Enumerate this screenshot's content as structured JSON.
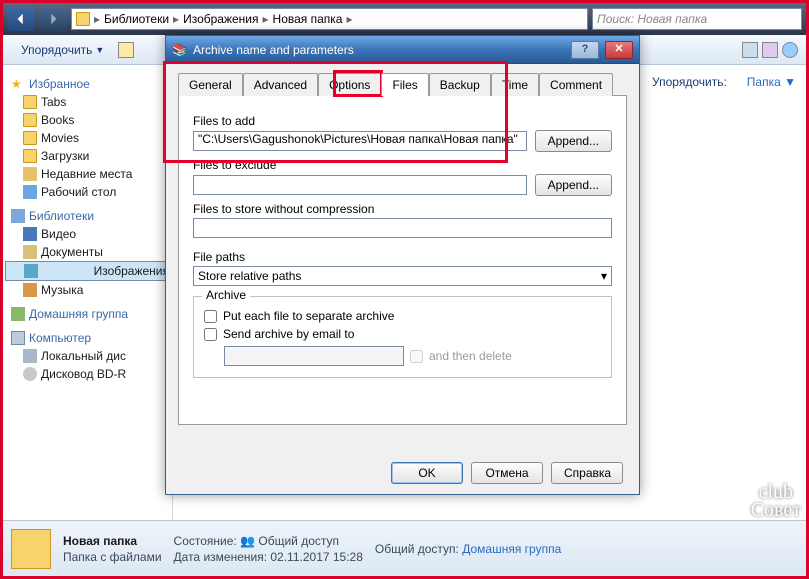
{
  "breadcrumb": {
    "p1": "Библиотеки",
    "p2": "Изображения",
    "p3": "Новая папка"
  },
  "search": {
    "placeholder": "Поиск: Новая папка"
  },
  "toolbar": {
    "organize": "Упорядочить"
  },
  "right_header": {
    "sort_label": "Упорядочить:",
    "sort_value": "Папка"
  },
  "tree": {
    "favorites": "Избранное",
    "tabs": "Tabs",
    "books": "Books",
    "movies": "Movies",
    "downloads": "Загрузки",
    "recent": "Недавние места",
    "desktop": "Рабочий стол",
    "libraries": "Библиотеки",
    "videos": "Видео",
    "documents": "Документы",
    "pictures": "Изображения",
    "music": "Музыка",
    "homegroup": "Домашняя группа",
    "computer": "Компьютер",
    "localdisk": "Локальный дис",
    "bdrom": "Дисковод BD-R"
  },
  "status": {
    "name": "Новая папка",
    "type": "Папка с файлами",
    "state_label": "Состояние:",
    "state_value": "Общий доступ",
    "date_label": "Дата изменения:",
    "date_value": "02.11.2017 15:28",
    "share_label": "Общий доступ:",
    "share_value": "Домашняя группа"
  },
  "dialog": {
    "title": "Archive name and parameters",
    "tabs": {
      "general": "General",
      "advanced": "Advanced",
      "options": "Options",
      "files": "Files",
      "backup": "Backup",
      "time": "Time",
      "comment": "Comment"
    },
    "files_to_add": "Files to add",
    "files_to_add_value": "\"C:\\Users\\Gagushonok\\Pictures\\Новая папка\\Новая папка\"",
    "append": "Append...",
    "files_to_exclude": "Files to exclude",
    "files_to_exclude_value": "",
    "files_no_compress": "Files to store without compression",
    "files_no_compress_value": "",
    "file_paths": "File paths",
    "file_paths_value": "Store relative paths",
    "archive_group": "Archive",
    "put_each": "Put each file to separate archive",
    "send_email": "Send archive by email to",
    "email_value": "",
    "then_delete": "and then delete",
    "ok": "OK",
    "cancel": "Отмена",
    "help": "Справка"
  },
  "watermark": "club\nСовет"
}
